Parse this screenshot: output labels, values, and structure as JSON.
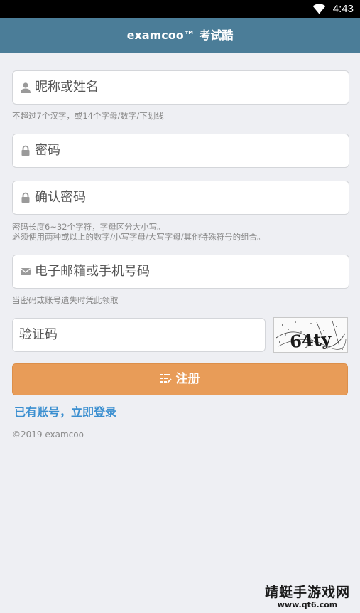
{
  "status_bar": {
    "time": "4:43"
  },
  "header": {
    "title": "examcoo™ 考试酷"
  },
  "form": {
    "nickname": {
      "placeholder": "昵称或姓名",
      "hint": "不超过7个汉字，或14个字母/数字/下划线",
      "icon": "user-icon"
    },
    "password": {
      "placeholder": "密码",
      "icon": "lock-icon"
    },
    "confirm_password": {
      "placeholder": "确认密码",
      "icon": "lock-icon",
      "hint_line1": "密码长度6~32个字符，字母区分大小写。",
      "hint_line2": "必须使用两种或以上的数字/小写字母/大写字母/其他特殊符号的组合。"
    },
    "contact": {
      "placeholder": "电子邮箱或手机号码",
      "hint": "当密码或账号遗失时凭此领取",
      "icon": "envelope-icon"
    },
    "captcha": {
      "placeholder": "验证码",
      "image_text": "64ty"
    },
    "register_label": "注册",
    "login_link": "已有账号，立即登录"
  },
  "footer": {
    "copyright": "©2019 examcoo"
  },
  "watermark": {
    "line1": "靖蜓手游戏网",
    "line2": "www.qt6.com"
  },
  "colors": {
    "header": "#4b7d98",
    "button": "#e89c58",
    "link": "#3b8fd0",
    "background": "#eeeff3"
  }
}
